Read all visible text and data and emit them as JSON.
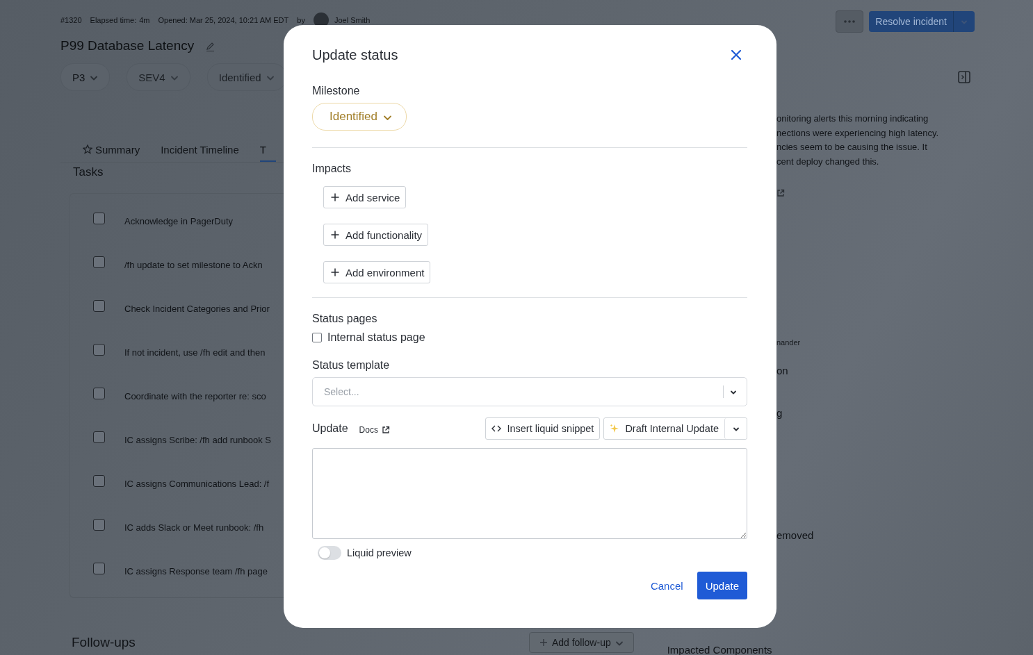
{
  "header": {
    "number": "#1320",
    "elapsed_label": "Elapsed time:",
    "elapsed": "4m",
    "opened": "Opened: Mar 25, 2024, 10:21 AM EDT",
    "by": "by",
    "owner": "Joel Smith"
  },
  "title": "P99 Database Latency",
  "actions": {
    "resolve": "Resolve incident"
  },
  "pills": [
    {
      "label": "P3"
    },
    {
      "label": "SEV4"
    },
    {
      "label": "Identified"
    }
  ],
  "tabs": [
    {
      "label": "Summary",
      "selected": false
    },
    {
      "label": "Incident Timeline",
      "selected": false
    },
    {
      "label": "T",
      "selected": true
    }
  ],
  "tasks": {
    "heading": "Tasks",
    "items": [
      {
        "label": "Acknowledge in PagerDuty",
        "checked": false
      },
      {
        "label": "/fh update to set milestone to Ackn",
        "checked": false
      },
      {
        "label": "Check Incident Categories and Prior",
        "checked": false
      },
      {
        "label": "If not incident, use /fh edit and then",
        "checked": false
      },
      {
        "label": "Coordinate with the reporter re: sco",
        "checked": false
      },
      {
        "label": "IC assigns Scribe: /fh add runbook S",
        "checked": false
      },
      {
        "label": "IC assigns Communications Lead: /f",
        "checked": false
      },
      {
        "label": "IC adds Slack or Meet runbook: /fh",
        "checked": false
      },
      {
        "label": "IC assigns Response team /fh page",
        "checked": false
      }
    ]
  },
  "follow_ups": {
    "heading": "Follow-ups",
    "add_button": "Add follow-up"
  },
  "right_panel": {
    "description_lines": [
      "onitoring alerts this morning indicating",
      "nections were experiencing high latency.",
      "ncies seem to be causing the issue. It",
      "cent deploy changed this."
    ],
    "fragments": [
      "nander",
      "on",
      "g",
      "emoved"
    ],
    "section": "Impacted Components"
  },
  "modal": {
    "title": "Update status",
    "milestone": {
      "label": "Milestone",
      "value": "Identified"
    },
    "impacts": {
      "label": "Impacts",
      "buttons": [
        "Add service",
        "Add functionality",
        "Add environment"
      ]
    },
    "status_pages": {
      "label": "Status pages",
      "options": [
        {
          "label": "Internal status page",
          "checked": false
        }
      ]
    },
    "template": {
      "label": "Status template",
      "placeholder": "Select..."
    },
    "update": {
      "label": "Update",
      "docs": "Docs",
      "snippet_button": "Insert liquid snippet",
      "draft_button": "Draft Internal Update"
    },
    "preview": {
      "label": "Liquid preview",
      "on": false
    },
    "buttons": {
      "cancel": "Cancel",
      "submit": "Update"
    }
  }
}
